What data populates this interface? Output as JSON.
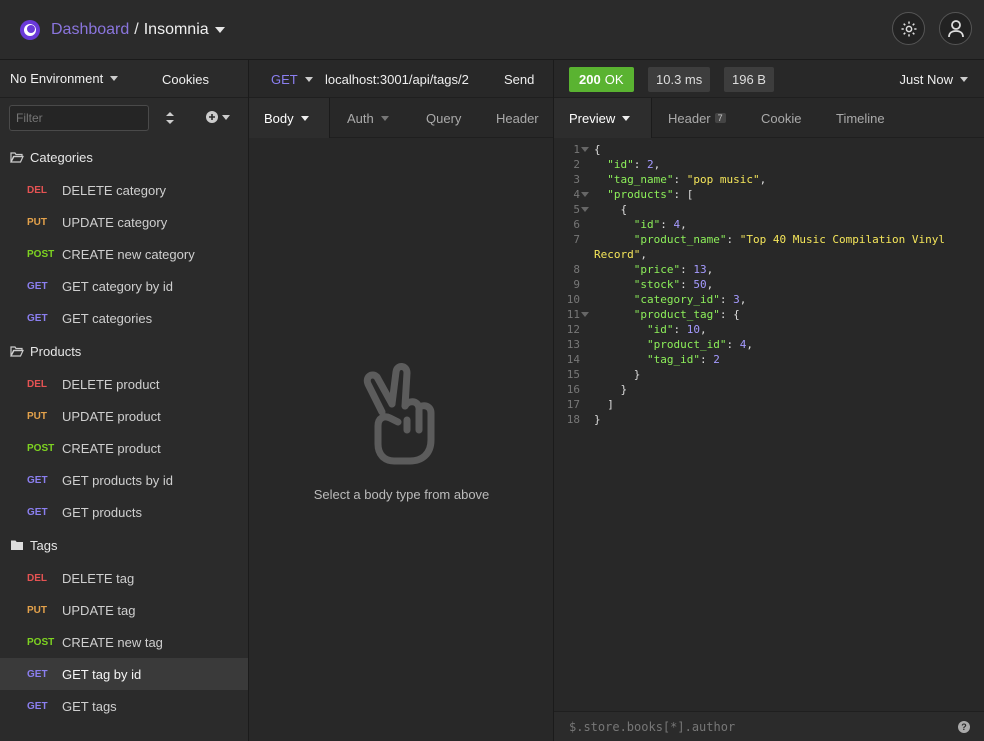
{
  "app": {
    "dashboard": "Dashboard",
    "separator": "/",
    "project": "Insomnia"
  },
  "sidebar": {
    "environment": "No Environment",
    "cookies": "Cookies",
    "filter_placeholder": "Filter",
    "folders": [
      {
        "name": "Categories",
        "items": [
          {
            "method": "DEL",
            "label": "DELETE category"
          },
          {
            "method": "PUT",
            "label": "UPDATE category"
          },
          {
            "method": "POST",
            "label": "CREATE new category"
          },
          {
            "method": "GET",
            "label": "GET category by id"
          },
          {
            "method": "GET",
            "label": "GET categories"
          }
        ]
      },
      {
        "name": "Products",
        "items": [
          {
            "method": "DEL",
            "label": "DELETE product"
          },
          {
            "method": "PUT",
            "label": "UPDATE product"
          },
          {
            "method": "POST",
            "label": "CREATE product"
          },
          {
            "method": "GET",
            "label": "GET products by id"
          },
          {
            "method": "GET",
            "label": "GET products"
          }
        ]
      },
      {
        "name": "Tags",
        "items": [
          {
            "method": "DEL",
            "label": "DELETE tag"
          },
          {
            "method": "PUT",
            "label": "UPDATE tag"
          },
          {
            "method": "POST",
            "label": "CREATE new tag"
          },
          {
            "method": "GET",
            "label": "GET tag by id"
          },
          {
            "method": "GET",
            "label": "GET tags"
          }
        ]
      }
    ]
  },
  "request": {
    "method": "GET",
    "url": "localhost:3001/api/tags/2",
    "send": "Send",
    "tabs": {
      "body": "Body",
      "auth": "Auth",
      "query": "Query",
      "header": "Header"
    },
    "empty_message": "Select a body type from above"
  },
  "response": {
    "status_code": "200",
    "status_text": "OK",
    "time": "10.3 ms",
    "size": "196 B",
    "when": "Just Now",
    "tabs": {
      "preview": "Preview",
      "header": "Header",
      "header_count": "7",
      "cookie": "Cookie",
      "timeline": "Timeline"
    },
    "filter_query": "$.store.books[*].author",
    "help": "?"
  },
  "colors": {
    "accent": "#6a39d8",
    "status_ok": "#5ab331",
    "get": "#8b7ff0",
    "post": "#7ed321",
    "put": "#e4a24b",
    "del": "#e55353"
  }
}
